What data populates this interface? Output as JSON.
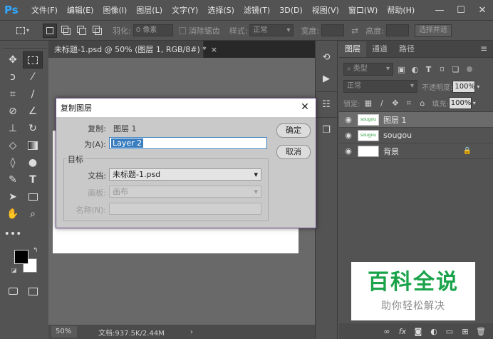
{
  "app": {
    "logo": "Ps"
  },
  "menu": [
    "文件(F)",
    "编辑(E)",
    "图像(I)",
    "图层(L)",
    "文字(Y)",
    "选择(S)",
    "滤镜(T)",
    "3D(D)",
    "视图(V)",
    "窗口(W)",
    "帮助(H)"
  ],
  "window_controls": {
    "minimize": "—",
    "maximize": "☐",
    "close": "✕"
  },
  "options": {
    "feather_label": "羽化:",
    "feather_value": "0 像素",
    "antialias_label": "消除锯齿",
    "style_label": "样式:",
    "style_value": "正常",
    "width_label": "宽度:",
    "height_label": "高度:",
    "select_mask_button": "选择并遮"
  },
  "document": {
    "tab_title": "未标题-1.psd @ 50% (图层 1, RGB/8#) *",
    "tab_close": "×",
    "zoom": "50%",
    "info": "文档:937.5K/2.44M",
    "info_arrow": "›"
  },
  "layers_panel": {
    "tabs": [
      "图层",
      "通道",
      "路径"
    ],
    "menu_glyph": "≡",
    "filter_label": "类型",
    "blend_mode": "正常",
    "opacity_label": "不透明度:",
    "opacity_value": "100%",
    "lock_label": "锁定:",
    "fill_label": "填充:",
    "fill_value": "100%",
    "layers": [
      {
        "name": "图层 1",
        "thumb_text": "sougou",
        "selected": true
      },
      {
        "name": "sougou",
        "thumb_text": "sougou",
        "selected": false
      },
      {
        "name": "背景",
        "thumb_text": "",
        "selected": false
      }
    ]
  },
  "dialog": {
    "title": "复制图层",
    "close_glyph": "✕",
    "copy_label": "复制:",
    "copy_value": "图层 1",
    "as_label": "为(A):",
    "as_value": "Layer 2",
    "target_label": "目标",
    "document_label": "文档:",
    "document_value": "未标题-1.psd",
    "artboard_label": "画板:",
    "artboard_value": "画布",
    "name_label": "名称(N):",
    "ok_button": "确定",
    "cancel_button": "取消"
  },
  "watermark": {
    "title": "百科全说",
    "subtitle": "助你轻松解决"
  },
  "colors": {
    "accent": "#31a8ff",
    "watermark_green": "#1aa34a",
    "selection_blue": "#3a7ebf"
  }
}
